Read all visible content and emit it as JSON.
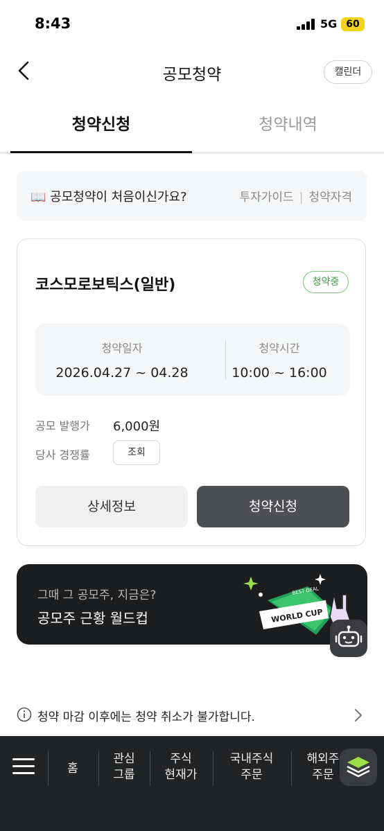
{
  "status_bar": {
    "time": "8:43",
    "network": "5G",
    "battery": "60"
  },
  "header": {
    "title": "공모청약",
    "calendar_label": "캘린더"
  },
  "tabs": [
    {
      "label": "청약신청",
      "active": true
    },
    {
      "label": "청약내역",
      "active": false
    }
  ],
  "guide": {
    "text": "📖 공모청약이 처음이신가요?",
    "links": [
      "투자가이드",
      "청약자격"
    ]
  },
  "offering": {
    "name": "코스모로보틱스(일반)",
    "status": "청약중",
    "date_label": "청약일자",
    "date_value": "2026.04.27 ~ 04.28",
    "time_label": "청약시간",
    "time_value": "10:00 ~ 16:00",
    "price_label": "공모 발행가",
    "price_value": "6,000원",
    "competition_label": "당사 경쟁률",
    "lookup_label": "조회",
    "detail_button": "상세정보",
    "apply_button": "청약신청"
  },
  "promo": {
    "subtitle": "그때 그 공모주, 지금은?",
    "title": "공모주 근황 월드컵",
    "badge_top": "BEST DEAL",
    "badge_main": "WORLD CUP"
  },
  "notice": {
    "text": "청약 마감 이후에는 청약 취소가 불가합니다."
  },
  "bottom_nav": {
    "items": [
      "홈",
      "관심\n그룹",
      "주식\n현재가",
      "국내주식\n주문",
      "해외주\n주문"
    ]
  },
  "colors": {
    "accent_dark": "#4d4f52",
    "badge_green": "#3aa23f",
    "promo_bg": "#1c1d1f",
    "bottom_nav_bg": "#222325"
  }
}
